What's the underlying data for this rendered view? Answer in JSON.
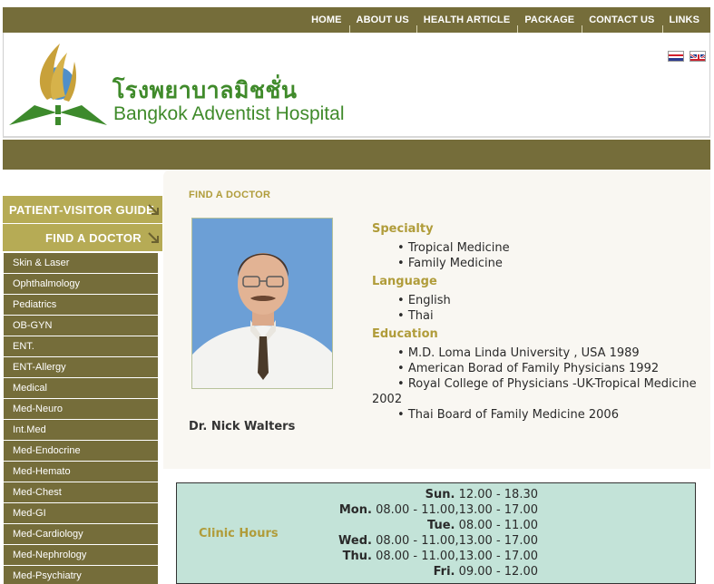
{
  "nav": [
    "HOME",
    "ABOUT US",
    "HEALTH ARTICLE",
    "PACKAGE",
    "CONTACT US",
    "LINKS"
  ],
  "header": {
    "thai_name": "โรงพยาบาลมิชชั่น",
    "english_name": "Bangkok Adventist Hospital",
    "flags": [
      "thai-flag-icon",
      "uk-flag-icon"
    ]
  },
  "sidebar": {
    "guide_label": "PATIENT-VISITOR GUIDE",
    "find_label": "FIND A DOCTOR",
    "items": [
      "Skin & Laser",
      "Ophthalmology",
      "Pediatrics",
      "OB-GYN",
      "ENT.",
      "ENT-Allergy",
      "Medical",
      "Med-Neuro",
      "Int.Med",
      "Med-Endocrine",
      "Med-Hemato",
      "Med-Chest",
      "Med-GI",
      "Med-Cardiology",
      "Med-Nephrology",
      "Med-Psychiatry"
    ]
  },
  "main": {
    "page_title": "FIND A DOCTOR",
    "doctor_name": "Dr. Nick Walters",
    "specialty_heading": "Specialty",
    "specialties": [
      "Tropical Medicine",
      "Family Medicine"
    ],
    "language_heading": "Language",
    "languages": [
      "English",
      "Thai"
    ],
    "education_heading": "Education",
    "education": [
      "M.D. Loma Linda University , USA 1989",
      "American Borad of Family Physicians 1992",
      "Royal College of Physicians -UK-Tropical Medicine 2002",
      "Thai Board of Family Medicine 2006"
    ]
  },
  "clinic": {
    "label": "Clinic Hours",
    "rows": [
      {
        "day": "Sun.",
        "time": "12.00 - 18.30"
      },
      {
        "day": "Mon.",
        "time": "08.00 - 11.00,13.00 - 17.00"
      },
      {
        "day": "Tue.",
        "time": "08.00 - 11.00"
      },
      {
        "day": "Wed.",
        "time": "08.00 - 11.00,13.00 - 17.00"
      },
      {
        "day": "Thu.",
        "time": "08.00 - 11.00,13.00 - 17.00"
      },
      {
        "day": "Fri.",
        "time": "09.00 - 12.00"
      }
    ]
  },
  "colors": {
    "olive": "#756d3a",
    "gold": "#b6ab55",
    "heading": "#b09c3a",
    "green_text": "#3f8a2a",
    "hours_bg": "#c3e3d8"
  }
}
